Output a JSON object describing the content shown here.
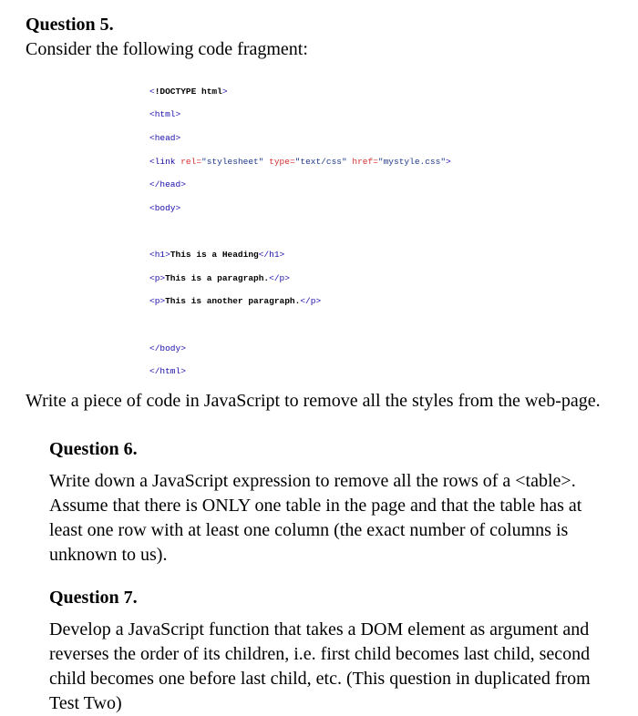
{
  "q5": {
    "heading": "Question 5.",
    "intro": "Consider the following code fragment:",
    "code": {
      "l1_doctype_lt": "<",
      "l1_doctype_excl": "!DOCTYPE html",
      "l1_doctype_gt": ">",
      "l2": "<html>",
      "l3": "<head>",
      "l4_link_open": "<link ",
      "l4_rel_name": "rel=",
      "l4_rel_val": "\"stylesheet\"",
      "l4_type_name": " type=",
      "l4_type_val": "\"text/css\"",
      "l4_href_name": " href=",
      "l4_href_val": "\"mystyle.css\"",
      "l4_link_close": ">",
      "l5": "</head>",
      "l6": "<body>",
      "blank1": " ",
      "l7_open": "<h1>",
      "l7_text": "This is a Heading",
      "l7_close": "</h1>",
      "l8_open": "<p>",
      "l8_text": "This is a paragraph.",
      "l8_close": "</p>",
      "l9_open": "<p>",
      "l9_text": "This is another paragraph.",
      "l9_close": "</p>",
      "blank2": " ",
      "l10": "</body>",
      "l11": "</html>"
    },
    "body": "Write a piece of code in JavaScript to remove all the styles from the web-page."
  },
  "q6": {
    "heading": "Question 6.",
    "body": "Write down a JavaScript expression to remove all the rows of a <table>. Assume that there is ONLY one table in the page and that the table has at least one row with at least one column (the exact number of columns is unknown to us)."
  },
  "q7": {
    "heading": "Question 7.",
    "body": "Develop a JavaScript function that takes a DOM element as argument and reverses the order of its children, i.e. first child becomes last child, second child becomes one before last child, etc. (This question in duplicated from Test Two)"
  }
}
